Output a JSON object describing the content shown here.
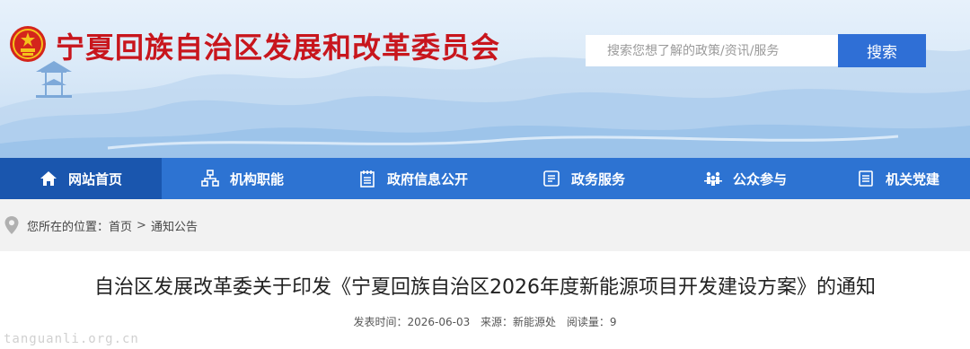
{
  "header": {
    "site_title": "宁夏回族自治区发展和改革委员会",
    "search_placeholder": "搜索您想了解的政策/资讯/服务",
    "search_button": "搜索"
  },
  "nav": {
    "items": [
      {
        "label": "网站首页",
        "icon": "home-icon",
        "active": true
      },
      {
        "label": "机构职能",
        "icon": "org-chart-icon",
        "active": false
      },
      {
        "label": "政府信息公开",
        "icon": "document-list-icon",
        "active": false
      },
      {
        "label": "政务服务",
        "icon": "service-list-icon",
        "active": false
      },
      {
        "label": "公众参与",
        "icon": "people-icon",
        "active": false
      },
      {
        "label": "机关党建",
        "icon": "notes-icon",
        "active": false
      }
    ]
  },
  "breadcrumb": {
    "prefix": "您所在的位置：",
    "items": [
      "首页",
      "通知公告"
    ],
    "separator": ">"
  },
  "article": {
    "title": "自治区发展改革委关于印发《宁夏回族自治区2026年度新能源项目开发建设方案》的通知",
    "published_label": "发表时间：2026-06-03",
    "source_label": "来源：新能源处",
    "views_label": "阅读量：9"
  },
  "watermark": "tanguanli.org.cn",
  "colors": {
    "title_red": "#c8161d",
    "nav_blue": "#2d73d2",
    "nav_active": "#1a56ae",
    "search_blue": "#2f6fd6"
  }
}
